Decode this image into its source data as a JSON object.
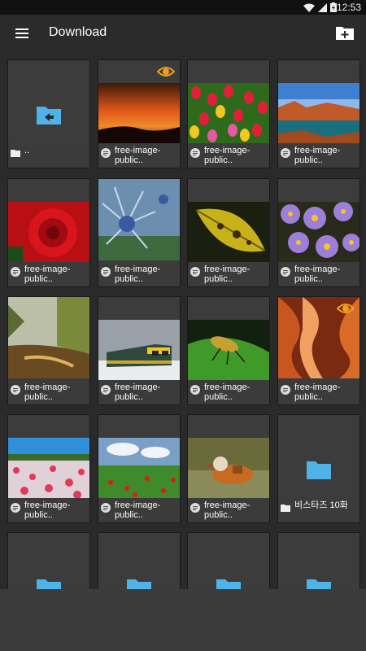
{
  "status_bar": {
    "time": "12:53"
  },
  "app_bar": {
    "title": "Download"
  },
  "tiles": [
    {
      "kind": "folder-up",
      "label": ".."
    },
    {
      "kind": "image",
      "label": "free-image-public..",
      "image": "sunset-sky",
      "eye": true
    },
    {
      "kind": "image",
      "label": "free-image-public..",
      "image": "tulips"
    },
    {
      "kind": "image",
      "label": "free-image-public..",
      "image": "lake-canyon"
    },
    {
      "kind": "image",
      "label": "free-image-public..",
      "image": "red-rose"
    },
    {
      "kind": "image",
      "label": "free-image-public..",
      "image": "blue-thistle"
    },
    {
      "kind": "image",
      "label": "free-image-public..",
      "image": "yellow-leaf"
    },
    {
      "kind": "image",
      "label": "free-image-public..",
      "image": "purple-asters"
    },
    {
      "kind": "image",
      "label": "free-image-public..",
      "image": "foggy-river"
    },
    {
      "kind": "image",
      "label": "free-image-public..",
      "image": "train-snow"
    },
    {
      "kind": "image",
      "label": "free-image-public..",
      "image": "beetle-leaf"
    },
    {
      "kind": "image",
      "label": "free-image-public..",
      "image": "antelope-canyon",
      "eye": true
    },
    {
      "kind": "image",
      "label": "free-image-public..",
      "image": "flower-field"
    },
    {
      "kind": "image",
      "label": "free-image-public..",
      "image": "poppy-meadow"
    },
    {
      "kind": "image",
      "label": "free-image-public..",
      "image": "mandarin-duck"
    },
    {
      "kind": "folder",
      "label": "비스타즈 10화"
    },
    {
      "kind": "folder",
      "label": ""
    },
    {
      "kind": "folder",
      "label": ""
    },
    {
      "kind": "folder",
      "label": ""
    },
    {
      "kind": "folder",
      "label": ""
    }
  ],
  "colors": {
    "accent": "#4fb3e8",
    "eye": "#f0a01e",
    "app_bar": "#2b2b2b"
  }
}
